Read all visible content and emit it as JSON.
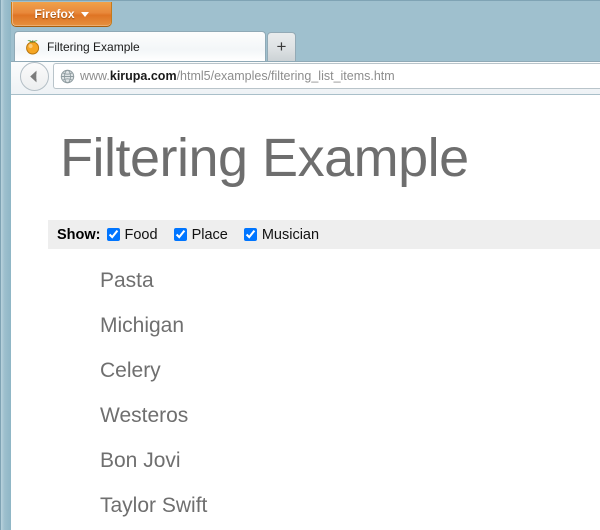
{
  "browser": {
    "menu_button_label": "Firefox",
    "menu_button_caret_icon": "chevron-down-icon",
    "tab": {
      "title": "Filtering Example",
      "favicon_icon": "orange-fruit-favicon"
    },
    "new_tab_label": "+",
    "back_button_icon": "back-arrow-icon",
    "urlbar": {
      "identity_icon": "globe-icon",
      "protocol_prefix": "www.",
      "domain": "kirupa.com",
      "path": "/html5/examples/filtering_list_items.htm",
      "full_url": "www.kirupa.com/html5/examples/filtering_list_items.htm"
    }
  },
  "page": {
    "title": "Filtering Example",
    "filter": {
      "label": "Show:",
      "options": [
        {
          "id": "food",
          "label": "Food",
          "checked": true
        },
        {
          "id": "place",
          "label": "Place",
          "checked": true
        },
        {
          "id": "musician",
          "label": "Musician",
          "checked": true
        }
      ]
    },
    "items": [
      "Pasta",
      "Michigan",
      "Celery",
      "Westeros",
      "Bon Jovi",
      "Taylor Swift"
    ]
  },
  "colors": {
    "chrome_blue": "#9fc0ce",
    "firefox_orange": "#e8883b",
    "heading_gray": "#6e6e6e",
    "list_gray": "#6f6f6f",
    "filter_bar_gray": "#eeeeee"
  }
}
